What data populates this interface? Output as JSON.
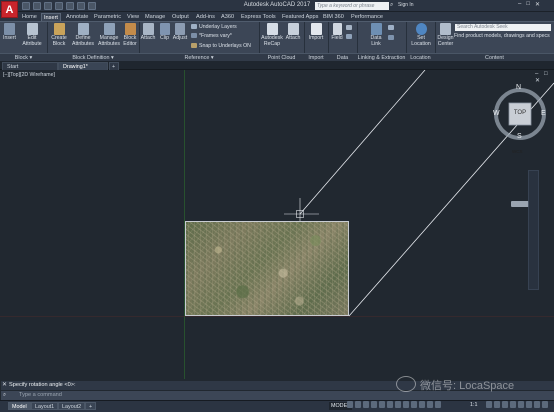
{
  "app": {
    "title": "Autodesk AutoCAD 2017",
    "logo": "A"
  },
  "titlebar": {
    "search_placeholder": "Type a keyword or phrase",
    "signin": "Sign In",
    "window_controls": [
      "–",
      "□",
      "✕"
    ]
  },
  "ribbon_tabs": [
    "Home",
    "Insert",
    "Annotate",
    "Parametric",
    "View",
    "Manage",
    "Output",
    "Add-ins",
    "A360",
    "Express Tools",
    "Featured Apps",
    "BIM 360",
    "Performance"
  ],
  "active_tab": "Insert",
  "ribbon": {
    "block_buttons": [
      "Insert",
      "Edit Attribute",
      "Create Block",
      "Define Attributes",
      "Manage Attributes",
      "Block Editor"
    ],
    "reference_buttons": [
      "Attach",
      "Clip",
      "Adjust"
    ],
    "reference_small": [
      "Underlay Layers",
      "*Frames vary*",
      "Snap to Underlays ON"
    ],
    "pointcloud_buttons": [
      "Autodesk ReCap",
      "Attach"
    ],
    "import_button": "Import",
    "data_button": "Field",
    "linking_button": "Data Link",
    "location_button": "Set Location",
    "content_button": "Design Center",
    "content_search": "Search Autodesk Seek",
    "content_text": "Find product models, drawings and specs",
    "panels": [
      "Block ▾",
      "Block Definition ▾",
      "Reference ▾",
      "Point Cloud",
      "Import",
      "Data",
      "Linking & Extraction",
      "Location",
      "Content"
    ]
  },
  "doc_tabs": [
    "Start",
    "Drawing1*",
    "+"
  ],
  "viewport": {
    "label": "[–][Top][2D Wireframe]",
    "controls": "– □ ✕",
    "viewcube": {
      "face": "TOP",
      "n": "N",
      "s": "S",
      "e": "E",
      "w": "W",
      "wcs": "WCS"
    }
  },
  "command": {
    "history": "Specify rotation angle <0>:",
    "input_placeholder": "Type a command"
  },
  "layout_tabs": [
    "Model",
    "Layout1",
    "Layout2",
    "+"
  ],
  "status": {
    "model": "MODEL",
    "scale": "1:1"
  },
  "watermark": "微信号: LocaSpace",
  "colors": {
    "ribbon": "#3c4656",
    "viewport": "#212830",
    "accent": "#c8252c"
  }
}
